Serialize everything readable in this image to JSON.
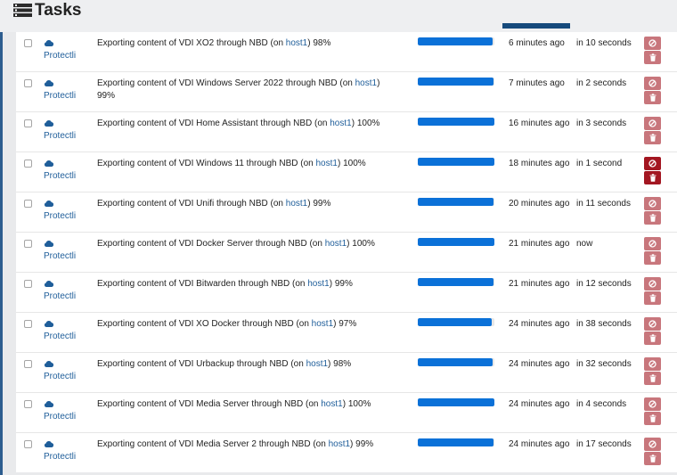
{
  "page": {
    "title": "Tasks",
    "title_icon": "tasks-list-icon"
  },
  "colors": {
    "progress_fill": "#0b71d8",
    "button_normal": "#c8767c",
    "button_hover": "#a31621",
    "link": "#1f5e9a"
  },
  "tasks": [
    {
      "prefix": "Exporting content of VDI XO2 through NBD (on ",
      "host": "host1",
      "suffix": ") 98%",
      "pool": "Protectli",
      "created": "6 minutes ago",
      "eta": "in 10 seconds",
      "progress": 98,
      "hovered": false
    },
    {
      "prefix": "Exporting content of VDI Windows Server 2022 through NBD (on ",
      "host": "host1",
      "suffix": ") 99%",
      "pool": "Protectli",
      "created": "7 minutes ago",
      "eta": "in 2 seconds",
      "progress": 99,
      "hovered": false
    },
    {
      "prefix": "Exporting content of VDI Home Assistant through NBD (on ",
      "host": "host1",
      "suffix": ") 100%",
      "pool": "Protectli",
      "created": "16 minutes ago",
      "eta": "in 3 seconds",
      "progress": 100,
      "hovered": false
    },
    {
      "prefix": "Exporting content of VDI Windows 11 through NBD (on ",
      "host": "host1",
      "suffix": ") 100%",
      "pool": "Protectli",
      "created": "18 minutes ago",
      "eta": "in 1 second",
      "progress": 100,
      "hovered": true
    },
    {
      "prefix": "Exporting content of VDI Unifi through NBD (on ",
      "host": "host1",
      "suffix": ") 99%",
      "pool": "Protectli",
      "created": "20 minutes ago",
      "eta": "in 11 seconds",
      "progress": 99,
      "hovered": false
    },
    {
      "prefix": "Exporting content of VDI Docker Server through NBD (on ",
      "host": "host1",
      "suffix": ") 100%",
      "pool": "Protectli",
      "created": "21 minutes ago",
      "eta": "now",
      "progress": 100,
      "hovered": false
    },
    {
      "prefix": "Exporting content of VDI Bitwarden through NBD (on ",
      "host": "host1",
      "suffix": ") 99%",
      "pool": "Protectli",
      "created": "21 minutes ago",
      "eta": "in 12 seconds",
      "progress": 99,
      "hovered": false
    },
    {
      "prefix": "Exporting content of VDI XO Docker through NBD (on ",
      "host": "host1",
      "suffix": ") 97%",
      "pool": "Protectli",
      "created": "24 minutes ago",
      "eta": "in 38 seconds",
      "progress": 97,
      "hovered": false
    },
    {
      "prefix": "Exporting content of VDI Urbackup through NBD (on ",
      "host": "host1",
      "suffix": ") 98%",
      "pool": "Protectli",
      "created": "24 minutes ago",
      "eta": "in 32 seconds",
      "progress": 98,
      "hovered": false
    },
    {
      "prefix": "Exporting content of VDI Media Server through NBD (on ",
      "host": "host1",
      "suffix": ") 100%",
      "pool": "Protectli",
      "created": "24 minutes ago",
      "eta": "in 4 seconds",
      "progress": 100,
      "hovered": false
    },
    {
      "prefix": "Exporting content of VDI Media Server 2 through NBD (on ",
      "host": "host1",
      "suffix": ") 99%",
      "pool": "Protectli",
      "created": "24 minutes ago",
      "eta": "in 17 seconds",
      "progress": 99,
      "hovered": false
    }
  ]
}
